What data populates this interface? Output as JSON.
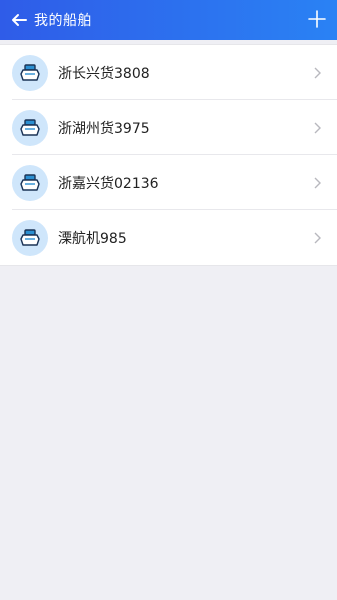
{
  "header": {
    "title": "我的船舶",
    "back_icon": "arrow-left-icon",
    "add_icon": "plus-icon"
  },
  "ships": [
    {
      "name": "浙长兴货3808",
      "icon": "ship-icon"
    },
    {
      "name": "浙湖州货3975",
      "icon": "ship-icon"
    },
    {
      "name": "浙嘉兴货02136",
      "icon": "ship-icon"
    },
    {
      "name": "溧航机985",
      "icon": "ship-icon"
    }
  ],
  "colors": {
    "header_start": "#2f5ce8",
    "header_end": "#2a82f4",
    "page_bg": "#efeff4",
    "avatar_bg": "#cfe6fb",
    "ship_outline": "#1a3356",
    "ship_fill": "#2b8fd1"
  }
}
